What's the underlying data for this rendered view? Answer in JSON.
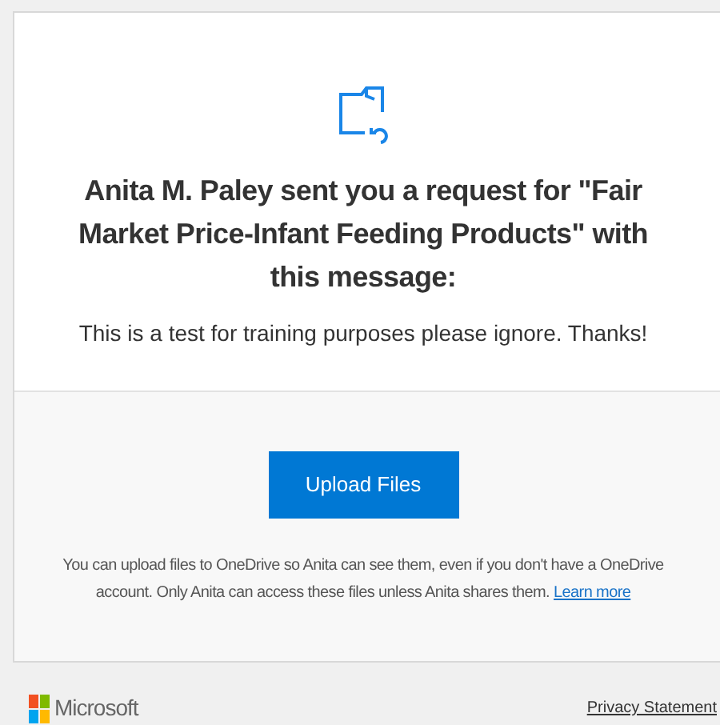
{
  "request": {
    "heading": "Anita M. Paley sent you a request for \"Fair Market Price-Infant Feeding Products\" with this message:",
    "message": "This is a test for training purposes please ignore. Thanks!"
  },
  "upload": {
    "button": "Upload Files",
    "note": "You can upload files to OneDrive so Anita can see them, even if you don't have a OneDrive account. Only Anita can access these files unless Anita shares them.",
    "link": "Learn more"
  },
  "footer": {
    "brand": "Microsoft",
    "privacy": "Privacy Statement"
  }
}
